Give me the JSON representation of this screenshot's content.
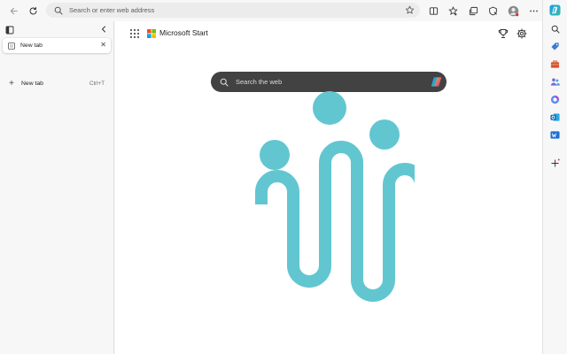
{
  "toolbar": {
    "address_placeholder": "Search or enter web address"
  },
  "tab_panel": {
    "tabs": [
      {
        "title": "New tab"
      }
    ],
    "new_tab_label": "New tab",
    "new_tab_shortcut": "Ctrl+T"
  },
  "page": {
    "brand": "Microsoft Start",
    "search_placeholder": "Search the web"
  },
  "colors": {
    "accent": "#0f6cbd",
    "hero_teal": "#62c6d1",
    "search_bg": "#424242"
  },
  "icons": {
    "toolbar": [
      "back-icon",
      "refresh-icon",
      "search-icon",
      "favorite-star-icon",
      "split-screen-icon",
      "favorites-icon",
      "collections-icon",
      "browser-essentials-icon",
      "profile-avatar",
      "more-options-icon"
    ],
    "sidebar": [
      "copilot-icon",
      "search-icon",
      "shopping-tag-icon",
      "tools-briefcase-icon",
      "people-icon",
      "m365-icon",
      "outlook-icon",
      "word-icon",
      "add-icon"
    ]
  }
}
